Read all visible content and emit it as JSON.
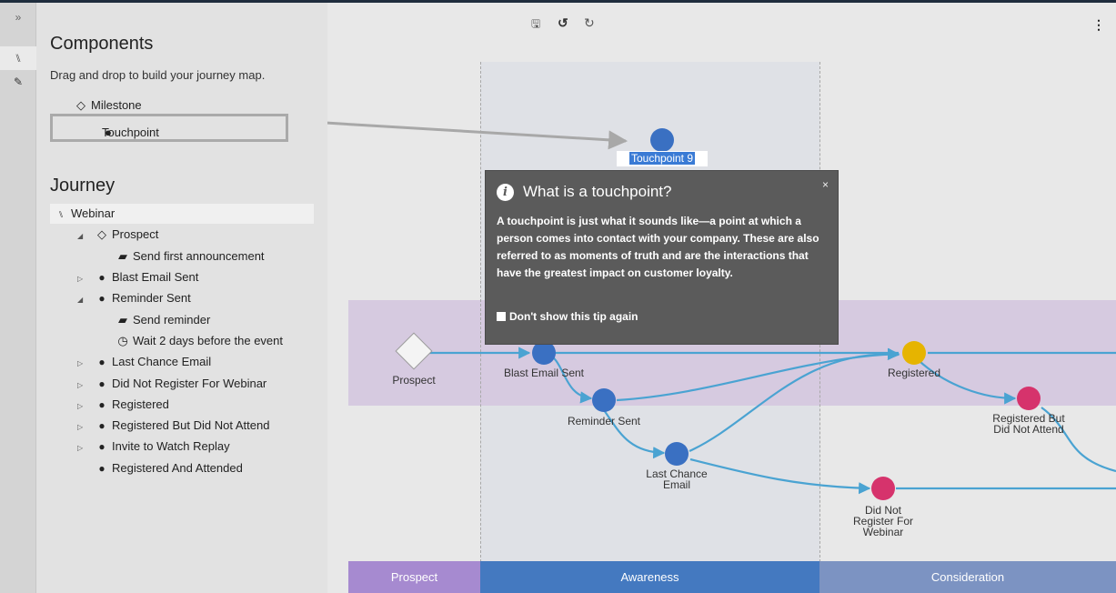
{
  "rail": {
    "collapse": "»",
    "journey_glyph": "⑊",
    "edit_glyph": "✎"
  },
  "components": {
    "title": "Components",
    "subtitle": "Drag and drop to build your journey map.",
    "items": [
      {
        "glyph": "◇",
        "label": "Milestone"
      },
      {
        "glyph": "●",
        "label": "Touchpoint"
      }
    ]
  },
  "journey": {
    "title": "Journey",
    "root": "Webinar",
    "rows": [
      {
        "toggle": "◢",
        "glyph": "◇",
        "label": "Prospect"
      },
      {
        "toggle": "",
        "glyph": "▰",
        "label": "Send first announcement"
      },
      {
        "toggle": "▷",
        "glyph": "●",
        "label": "Blast Email Sent"
      },
      {
        "toggle": "◢",
        "glyph": "●",
        "label": "Reminder Sent"
      },
      {
        "toggle": "",
        "glyph": "▰",
        "label": "Send reminder"
      },
      {
        "toggle": "",
        "glyph": "◷",
        "label": "Wait 2 days before the event"
      },
      {
        "toggle": "▷",
        "glyph": "●",
        "label": "Last Chance Email"
      },
      {
        "toggle": "▷",
        "glyph": "●",
        "label": "Did Not Register For Webinar"
      },
      {
        "toggle": "▷",
        "glyph": "●",
        "label": "Registered"
      },
      {
        "toggle": "▷",
        "glyph": "●",
        "label": "Registered But Did Not Attend"
      },
      {
        "toggle": "▷",
        "glyph": "●",
        "label": "Invite to Watch Replay"
      },
      {
        "toggle": "",
        "glyph": "●",
        "label": "Registered And Attended"
      }
    ]
  },
  "toolbar": {
    "save": "🖫",
    "undo": "↺",
    "redo": "↻",
    "more": "⋮"
  },
  "stages": [
    "Prospect",
    "Awareness",
    "Consideration"
  ],
  "nodes": {
    "prospect": "Prospect",
    "blast": "Blast Email Sent",
    "reminder": "Reminder Sent",
    "last_chance_1": "Last Chance",
    "last_chance_2": "Email",
    "registered": "Registered",
    "rbdna_1": "Registered But",
    "rbdna_2": "Did Not Attend",
    "dnr_1": "Did Not",
    "dnr_2": "Register For",
    "dnr_3": "Webinar",
    "touchpoint9": "Touchpoint 9"
  },
  "tooltip": {
    "title": "What is a touchpoint?",
    "body": "A touchpoint is just what it sounds like—a point at which a person comes into contact with your company. These are also referred to as moments of truth and are the interactions that have the greatest impact on customer loyalty.",
    "checkbox": "Don't show this tip again",
    "close": "×"
  },
  "colors": {
    "blue_node": "#3a70c2",
    "yellow_node": "#e6b400",
    "pink_node": "#d6336c",
    "flow_line": "#4aa3d2",
    "stage_prospect": "#a68ad0",
    "stage_awareness": "#4479c0",
    "stage_consideration": "#7c93c2"
  }
}
